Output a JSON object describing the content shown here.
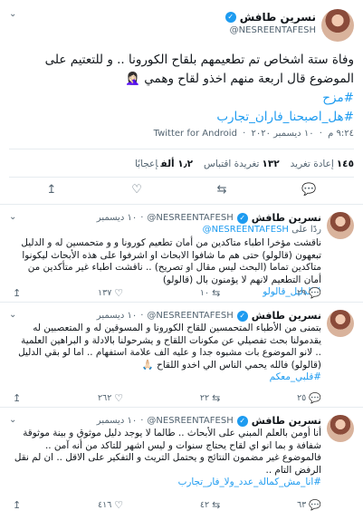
{
  "main_tweet": {
    "name": "نسرين طافش",
    "verified_glyph": "✓",
    "handle": "@NESREENTAFESH",
    "text": "وفاة ستة اشخاص تم تطعيمهم بلقاح الكورونا .. و للتعتيم على الموضوع قال اربعة منهم اخذو لقاح وهمي 🤦🏻‍♀️",
    "hashtags": [
      "#مزح",
      "#هل_اصبحنا_فاران_تجارب"
    ],
    "time": "٩:٢٤ م",
    "date": "١٠ ديسمبر ٢٠٢٠",
    "client": "Twitter for Android",
    "stats": {
      "retweets_value": "١٤٥",
      "retweets_label": "إعادة تغريد",
      "quotes_value": "١٣٢",
      "quotes_label": "تغريدة اقتباس",
      "likes_value": "١٫٢ ألف",
      "likes_label": "إعجابًا"
    }
  },
  "replies": [
    {
      "name": "نسرين طافش",
      "handle": "@NESREENTAFESH",
      "date": "١٠ ديسمبر",
      "replying_prefix": "ردًا على",
      "replying_to": "@NESREENTAFESH",
      "text": "ناقشت مؤخرا اطباء متاكدين من أمان تطعيم كورونا و و متحمسين له و الدليل تبعهون (قالولو) حتى هم ما شافوا الابحاث او اشرفوا على هذه الأبحاث ليكونوا متاكدين تماما (البحث ليس مقال او تصريح) .. ناقشت اطباء غير متأكدين من أمان التطعيم لانهم لا يؤمنون بال (قالولو)",
      "hashtag": "#الدليل_قالولو",
      "counts": {
        "reply": "٢٩",
        "retweet": "١٠",
        "like": "١٣٧"
      }
    },
    {
      "name": "نسرين طافش",
      "handle": "@NESREENTAFESH",
      "date": "١٠ ديسمبر",
      "text": "بتمنى من الأطباء المتحمسين للقاح الكورونا و المسوقين له و المتعصبين له يقدمولنا بحث تفصيلي عن مكونات اللقاح و يشرحولنا بالادلة و البراهين العلمية .. لانو الموضوع بات مشبوه جدا و عليه الف علامة استفهام .. اما لو بقي الدليل (قالولو) فالله يحمي الناس الي اخدو اللقاح 🙏🏻",
      "hashtag": "#قلبي_معكم",
      "counts": {
        "reply": "٢٥",
        "retweet": "٢٢",
        "like": "٢٦٢"
      }
    },
    {
      "name": "نسرين طافش",
      "handle": "@NESREENTAFESH",
      "date": "١٠ ديسمبر",
      "text": "أنا أومن بالعلم المبني على الأبحاث .. طالما لا يوجد دليل موثوق و بينة موثوقة شفافة و بما انو اي لقاح يحتاج سنوات و ليس اشهر للتاكد من أنه آمن .. فالموضوع غير مضمون النتائج و يحتمل التريث و التفكير على الاقل .. ان لم نقل الرفض التام ..",
      "hashtag": "#انا_مش_كمالة_عدد_ولا_فار_تجارب",
      "counts": {
        "reply": "٦٣",
        "retweet": "٤٢",
        "like": "٤١٦"
      }
    }
  ],
  "icons": {
    "caret": "⌄",
    "reply": "💬",
    "retweet": "⇆",
    "like": "♡",
    "share": "↥"
  },
  "colors": {
    "accent": "#1d9bf0",
    "text": "#0f1419",
    "muted": "#536471",
    "border": "#e6ecf0"
  }
}
